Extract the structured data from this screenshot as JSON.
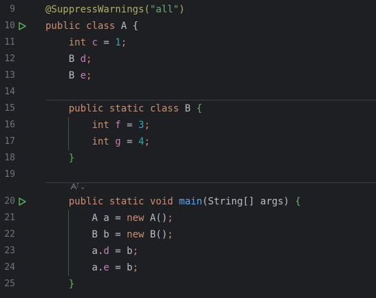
{
  "colors": {
    "background": "#1e1f22",
    "line_number": "#6f737a",
    "keyword": "#cf8e6d",
    "annotation": "#b3ae60",
    "string": "#6aab73",
    "number": "#2aacb8",
    "field": "#c77dbb",
    "method": "#56a8f5",
    "plain": "#bcbec4",
    "run_icon": "#5fb85f"
  },
  "lines": [
    {
      "num": "9",
      "tokens": [
        [
          "ann",
          "@SuppressWarnings("
        ],
        [
          "str",
          "\"all\""
        ],
        [
          "ann",
          ")"
        ]
      ]
    },
    {
      "num": "10",
      "run_icon": "run-class-icon",
      "tokens": [
        [
          "kw",
          "public "
        ],
        [
          "kw",
          "class "
        ],
        [
          "plain",
          "A "
        ],
        [
          "plain",
          "{"
        ]
      ]
    },
    {
      "num": "11",
      "tokens": [
        [
          "plain",
          "    "
        ],
        [
          "kw",
          "int "
        ],
        [
          "fld",
          "c"
        ],
        [
          "plain",
          " = "
        ],
        [
          "num",
          "1"
        ],
        [
          "kw",
          ";"
        ]
      ]
    },
    {
      "num": "12",
      "tokens": [
        [
          "plain",
          "    B "
        ],
        [
          "fld",
          "d"
        ],
        [
          "kw",
          ";"
        ]
      ]
    },
    {
      "num": "13",
      "tokens": [
        [
          "plain",
          "    B "
        ],
        [
          "fld",
          "e"
        ],
        [
          "kw",
          ";"
        ]
      ]
    },
    {
      "num": "14",
      "tokens": []
    },
    {
      "num": "15",
      "tokens": [
        [
          "plain",
          "    "
        ],
        [
          "kw",
          "public "
        ],
        [
          "kw",
          "static "
        ],
        [
          "kw",
          "class "
        ],
        [
          "plain",
          "B "
        ],
        [
          "brace",
          "{"
        ]
      ]
    },
    {
      "num": "16",
      "tokens": [
        [
          "plain",
          "        "
        ],
        [
          "kw",
          "int "
        ],
        [
          "fld",
          "f"
        ],
        [
          "plain",
          " = "
        ],
        [
          "num",
          "3"
        ],
        [
          "kw",
          ";"
        ]
      ]
    },
    {
      "num": "17",
      "tokens": [
        [
          "plain",
          "        "
        ],
        [
          "kw",
          "int "
        ],
        [
          "fld",
          "g"
        ],
        [
          "plain",
          " = "
        ],
        [
          "num",
          "4"
        ],
        [
          "kw",
          ";"
        ]
      ]
    },
    {
      "num": "18",
      "tokens": [
        [
          "plain",
          "    "
        ],
        [
          "brace",
          "}"
        ]
      ]
    },
    {
      "num": "19",
      "tokens": []
    },
    {
      "num": "20",
      "run_icon": "run-main-icon",
      "tokens": [
        [
          "plain",
          "    "
        ],
        [
          "kw",
          "public "
        ],
        [
          "kw",
          "static "
        ],
        [
          "kw",
          "void "
        ],
        [
          "fn",
          "main"
        ],
        [
          "plain",
          "(String[] args) "
        ],
        [
          "brace",
          "{"
        ]
      ]
    },
    {
      "num": "21",
      "tokens": [
        [
          "plain",
          "        A a = "
        ],
        [
          "kw",
          "new "
        ],
        [
          "plain",
          "A()"
        ],
        [
          "kw",
          ";"
        ]
      ]
    },
    {
      "num": "22",
      "tokens": [
        [
          "plain",
          "        B b = "
        ],
        [
          "kw",
          "new "
        ],
        [
          "plain",
          "B()"
        ],
        [
          "kw",
          ";"
        ]
      ]
    },
    {
      "num": "23",
      "tokens": [
        [
          "plain",
          "        a."
        ],
        [
          "fld",
          "d"
        ],
        [
          "plain",
          " = b"
        ],
        [
          "kw",
          ";"
        ]
      ]
    },
    {
      "num": "24",
      "tokens": [
        [
          "plain",
          "        a."
        ],
        [
          "fld",
          "e"
        ],
        [
          "plain",
          " = b"
        ],
        [
          "kw",
          ";"
        ]
      ]
    },
    {
      "num": "25",
      "tokens": [
        [
          "plain",
          "    "
        ],
        [
          "brace",
          "}"
        ]
      ]
    }
  ],
  "inlay_hint": {
    "icon": "ai-assistant-icon",
    "chevron": "⌄"
  }
}
